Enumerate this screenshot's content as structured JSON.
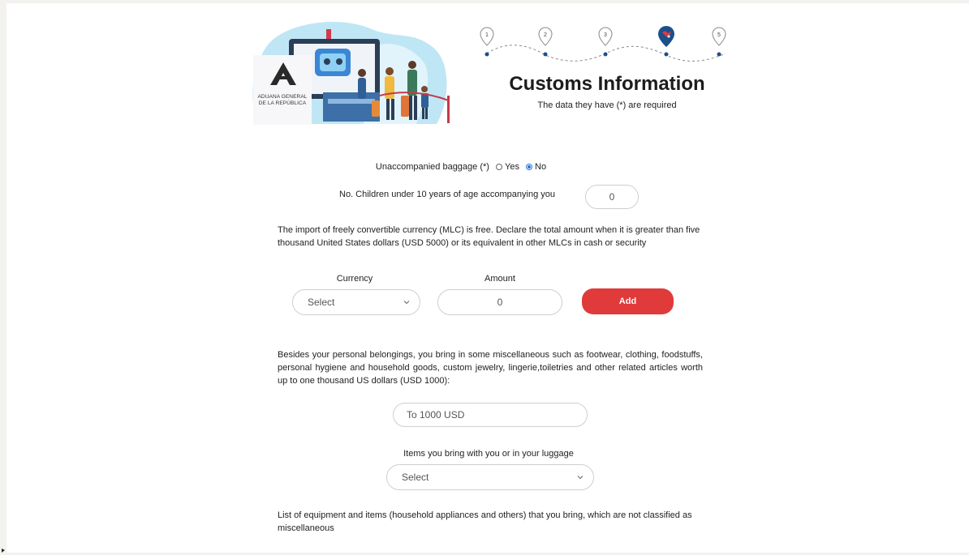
{
  "header": {
    "logo_line1": "ADUANA GENERAL",
    "logo_line2": "DE LA REPÚBLICA",
    "steps": [
      "1",
      "2",
      "3",
      "4",
      "5"
    ],
    "active_step": 4,
    "title": "Customs Information",
    "subtitle": "The data they have (*) are required"
  },
  "form": {
    "baggage": {
      "label": "Unaccompanied baggage (*)",
      "yes_label": "Yes",
      "no_label": "No",
      "selected": "No"
    },
    "children": {
      "label": "No. Children under 10 years of age accompanying you",
      "value": "0"
    },
    "currency_note": "The import of freely convertible currency (MLC) is free. Declare the total amount when it is greater than five thousand United States dollars (USD 5000) or its equivalent in other MLCs in cash or security",
    "currency": {
      "label": "Currency",
      "selected": "Select"
    },
    "amount": {
      "label": "Amount",
      "value": "0"
    },
    "add_label": "Add",
    "misc_note": "Besides your personal belongings, you bring in some miscellaneous such as footwear, clothing, foodstuffs, personal hygiene and household goods, custom jewelry, lingerie,toiletries and other related articles worth up to one thousand US dollars (USD 1000):",
    "misc_value": "To 1000 USD",
    "items": {
      "label": "Items you bring with you or in your luggage",
      "selected": "Select"
    },
    "equipment_note": "List of equipment and items (household appliances and others) that you bring, which are not classified as miscellaneous"
  },
  "colors": {
    "accent": "#e03a3a",
    "step_blue": "#1d4f8a",
    "radio_blue": "#2b73d8"
  }
}
